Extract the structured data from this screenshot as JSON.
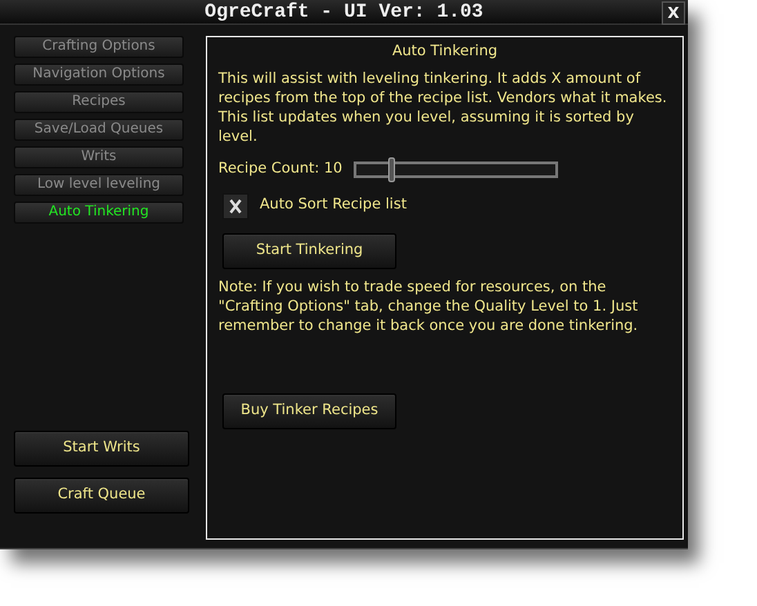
{
  "window": {
    "title": "OgreCraft - UI Ver: 1.03",
    "close": "X"
  },
  "tabs": [
    {
      "label": "Crafting Options",
      "selected": false
    },
    {
      "label": "Navigation Options",
      "selected": false
    },
    {
      "label": "Recipes",
      "selected": false
    },
    {
      "label": "Save/Load Queues",
      "selected": false
    },
    {
      "label": "Writs",
      "selected": false
    },
    {
      "label": "Low level leveling",
      "selected": false
    },
    {
      "label": "Auto Tinkering",
      "selected": true
    }
  ],
  "side_buttons": [
    "Start Writs",
    "Craft Queue"
  ],
  "panel": {
    "title": "Auto Tinkering",
    "description": "This will assist with leveling tinkering. It adds X amount of recipes from the top of the recipe list. Vendors what it makes. This list updates when you level, assuming it is sorted by level.",
    "slider": {
      "label": "Recipe Count: 10",
      "level": 0.18
    },
    "checkbox": {
      "label": "Auto Sort Recipe list",
      "checked": true
    },
    "start_button": "Start Tinkering",
    "note": "Note: If you wish to trade speed for resources, on the \"Crafting Options\" tab, change the Quality Level to 1. Just remember to change it back once you are done tinkering.",
    "buy_button": "Buy Tinker Recipes"
  }
}
